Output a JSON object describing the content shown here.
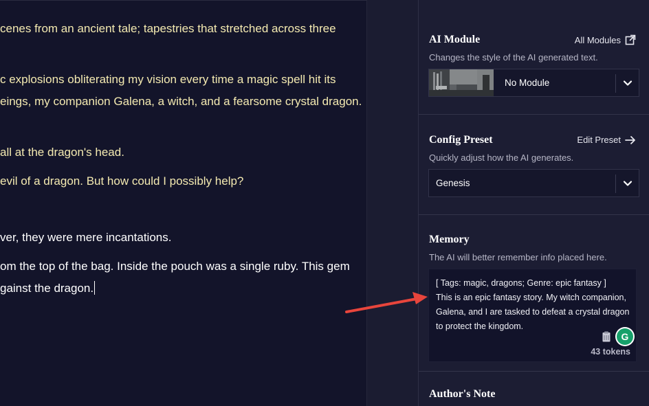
{
  "story": {
    "lines": [
      {
        "text": "cenes from an ancient tale; tapestries that stretched across three",
        "kind": "ai"
      },
      {
        "text": "c explosions obliterating my vision every time a magic spell hit its",
        "kind": "ai"
      },
      {
        "text": "eings, my companion Galena, a witch, and a fearsome crystal dragon.",
        "kind": "ai"
      },
      {
        "text": "all at the dragon's head.",
        "kind": "ai"
      },
      {
        "text": " evil of a dragon. But how could I possibly help?",
        "kind": "ai"
      },
      {
        "text": "ver, they were mere incantations.",
        "kind": "user"
      },
      {
        "text": "om the top of the bag. Inside the pouch was a single ruby. This gem",
        "kind": "user"
      },
      {
        "text": "gainst the dragon.",
        "kind": "user"
      }
    ]
  },
  "sidebar": {
    "ai_module": {
      "title": "AI Module",
      "link_label": "All Modules",
      "link_icon": "external-link-icon",
      "description": "Changes the style of the AI generated text.",
      "selected": "No Module"
    },
    "config_preset": {
      "title": "Config Preset",
      "link_label": "Edit Preset",
      "link_icon": "arrow-right-icon",
      "description": "Quickly adjust how the AI generates.",
      "selected": "Genesis"
    },
    "memory": {
      "title": "Memory",
      "description": "The AI will better remember info placed here.",
      "text": "[ Tags: magic, dragons; Genre: epic fantasy ]\nThis is an epic fantasy story. My witch companion,\nGalena, and I are tasked to defeat a crystal dragon\nto protect the kingdom.",
      "tokens": "43 tokens",
      "grammar_button": "G"
    },
    "authors_note": {
      "title": "Author's Note"
    }
  },
  "colors": {
    "ai_text": "#f4eab1",
    "user_text": "#ffffff",
    "annotation_arrow": "#e8453c",
    "grammar_green": "#16a06a"
  }
}
